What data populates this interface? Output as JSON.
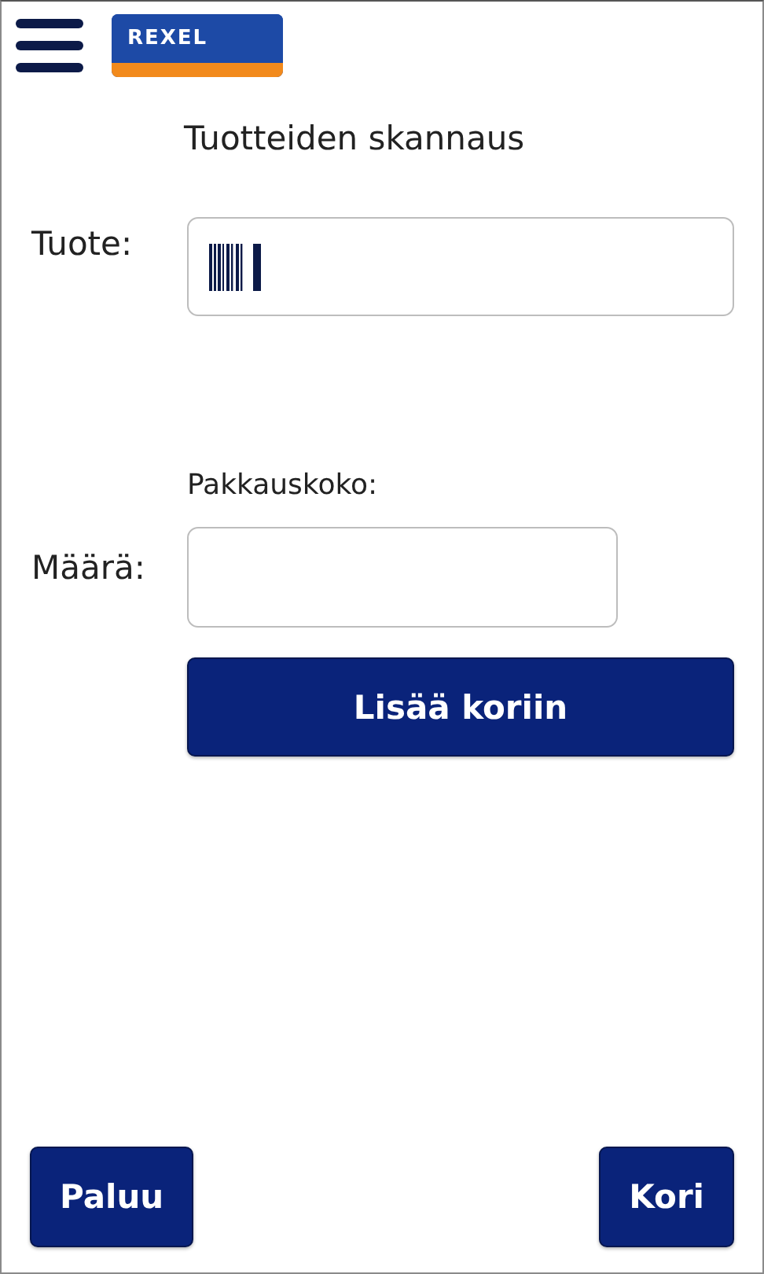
{
  "header": {
    "logo": "REXEL"
  },
  "title": "Tuotteiden skannaus",
  "product": {
    "label": "Tuote:"
  },
  "package_size": {
    "label": "Pakkauskoko:"
  },
  "quantity": {
    "label": "Määrä:"
  },
  "add_button": "Lisää koriin",
  "footer": {
    "back_button": "Paluu",
    "cart_button": "Kori"
  }
}
